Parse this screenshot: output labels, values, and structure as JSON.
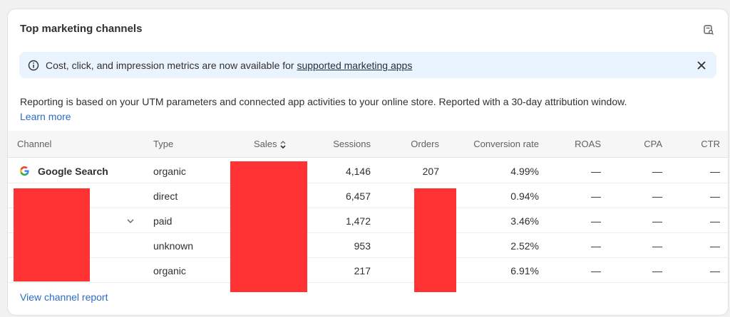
{
  "card": {
    "title": "Top marketing channels",
    "export_icon": "report-search-icon"
  },
  "banner": {
    "icon": "info-icon",
    "text_prefix": "Cost, click, and impression metrics are now available for ",
    "link_text": "supported marketing apps",
    "close_icon": "close-icon"
  },
  "description": {
    "text": "Reporting is based on your UTM parameters and connected app activities to your online store. Reported with a 30-day attribution window.",
    "learn_more": "Learn more"
  },
  "table": {
    "headers": {
      "channel": "Channel",
      "type": "Type",
      "sales": "Sales",
      "sessions": "Sessions",
      "orders": "Orders",
      "conversion_rate": "Conversion rate",
      "roas": "ROAS",
      "cpa": "CPA",
      "ctr": "CTR"
    },
    "rows": [
      {
        "channel": "Google Search",
        "type": "organic",
        "sessions": "4,146",
        "orders": "207",
        "conversion_rate": "4.99%",
        "roas": "—",
        "cpa": "—",
        "ctr": "—"
      },
      {
        "channel": "",
        "type": "direct",
        "sessions": "6,457",
        "orders": "",
        "conversion_rate": "0.94%",
        "roas": "—",
        "cpa": "—",
        "ctr": "—"
      },
      {
        "channel": "",
        "type": "paid",
        "sessions": "1,472",
        "orders": "",
        "conversion_rate": "3.46%",
        "roas": "—",
        "cpa": "—",
        "ctr": "—"
      },
      {
        "channel": "",
        "type": "unknown",
        "sessions": "953",
        "orders": "",
        "conversion_rate": "2.52%",
        "roas": "—",
        "cpa": "—",
        "ctr": "—"
      },
      {
        "channel": "",
        "type": "organic",
        "sessions": "217",
        "orders": "",
        "conversion_rate": "6.91%",
        "roas": "—",
        "cpa": "—",
        "ctr": "—"
      }
    ]
  },
  "footer": {
    "view_report": "View channel report"
  },
  "colors": {
    "redaction": "#ff3333",
    "link": "#2b6cc4",
    "banner_bg": "#eaf4ff"
  }
}
